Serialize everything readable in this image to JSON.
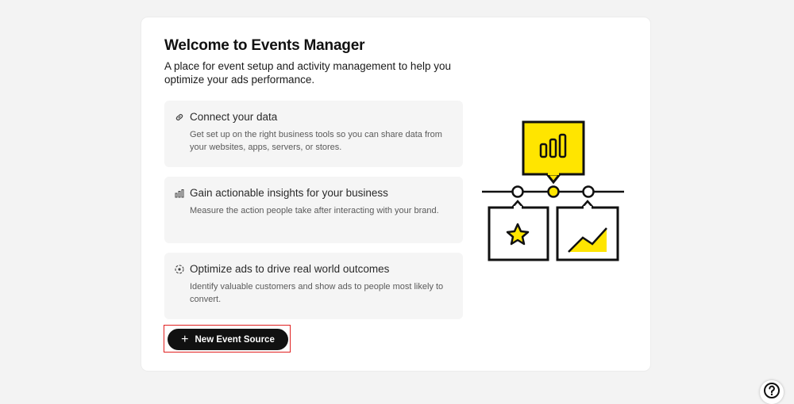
{
  "welcome": {
    "title": "Welcome to Events Manager",
    "subtitle": "A place for event setup and activity management to help you optimize your ads performance."
  },
  "features": [
    {
      "icon": "link-icon",
      "title": "Connect your data",
      "description": "Get set up on the right business tools so you can share data from your websites, apps, servers, or stores."
    },
    {
      "icon": "bar-chart-icon",
      "title": "Gain actionable insights for your business",
      "description": "Measure the action people take after interacting with your brand."
    },
    {
      "icon": "target-icon",
      "title": "Optimize ads to drive real world outcomes",
      "description": "Identify valuable customers and show ads to people most likely to convert."
    }
  ],
  "actions": {
    "new_event_source": "New Event Source",
    "help_icon": "question-mark-icon"
  },
  "colors": {
    "accent_yellow": "#FFE500",
    "button_black": "#111111",
    "highlight_red": "#E02020"
  }
}
